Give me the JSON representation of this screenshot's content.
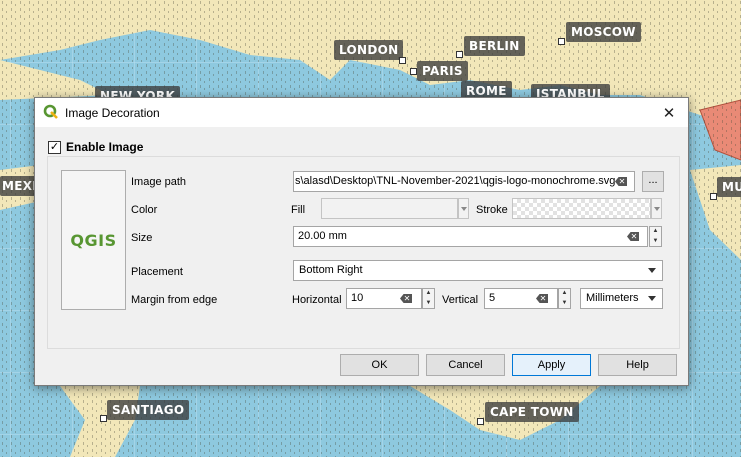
{
  "map": {
    "cities": [
      {
        "name": "LONDON"
      },
      {
        "name": "BERLIN"
      },
      {
        "name": "MOSCOW"
      },
      {
        "name": "PARIS"
      },
      {
        "name": "ROME"
      },
      {
        "name": "ISTANBUL"
      },
      {
        "name": "NEW YORK"
      },
      {
        "name": "MEXIC"
      },
      {
        "name": "MU"
      },
      {
        "name": "SANTIAGO"
      },
      {
        "name": "CAPE TOWN"
      }
    ]
  },
  "dialog": {
    "title": "Image Decoration",
    "close_glyph": "✕",
    "enable_label": "Enable Image",
    "enable_checked": "✓",
    "preview_logo_text": "QGIS",
    "labels": {
      "image_path": "Image path",
      "color": "Color",
      "size": "Size",
      "placement": "Placement",
      "margin": "Margin from edge",
      "fill": "Fill",
      "stroke": "Stroke",
      "horizontal": "Horizontal",
      "vertical": "Vertical"
    },
    "image_path_value": "s\\alasd\\Desktop\\TNL-November-2021\\qgis-logo-monochrome.svg",
    "browse_label": "...",
    "size_value": "20.00 mm",
    "placement_value": "Bottom Right",
    "horizontal_value": "10",
    "vertical_value": "5",
    "units_value": "Millimeters",
    "buttons": {
      "ok": "OK",
      "cancel": "Cancel",
      "apply": "Apply",
      "help": "Help"
    }
  }
}
